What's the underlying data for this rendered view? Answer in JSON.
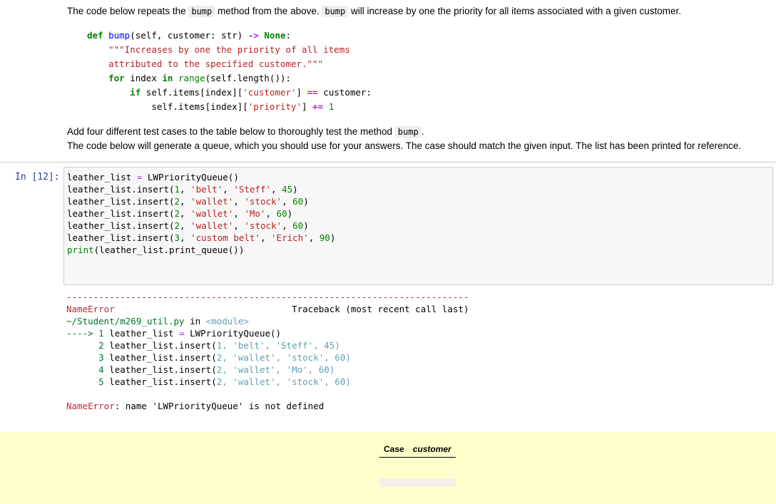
{
  "intro": {
    "p1_before": "The code below repeats the ",
    "p1_code1": "bump",
    "p1_mid": " method from the above. ",
    "p1_code2": "bump",
    "p1_after": " will increase by one the priority for all items associated with a given customer."
  },
  "md_code": {
    "l1_def": "def",
    "l1_name": "bump",
    "l1_args": "(self, customer: str) ",
    "l1_arrow": "->",
    "l1_none": "None",
    "l1_colon": ":",
    "l2": "\"\"\"Increases by one the priority of all items",
    "l3": "attributed to the specified customer.\"\"\"",
    "l4_for": "for",
    "l4_index": " index ",
    "l4_in": "in",
    "l4_range": "range",
    "l4_rest": "(self.length()):",
    "l5_if": "if",
    "l5_a": " self.items[index][",
    "l5_str": "'customer'",
    "l5_b": "] ",
    "l5_op": "==",
    "l5_c": " customer:",
    "l6_a": "self.items[index][",
    "l6_str": "'priority'",
    "l6_b": "] ",
    "l6_op": "+=",
    "l6_num": "1"
  },
  "instructions": {
    "p2_before": "Add four different test cases to the table below to thoroughly test the method ",
    "p2_code": "bump",
    "p2_after": ".",
    "p3": "The code below will generate a queue, which you should use for your answers. The case should match the given input. The list has been printed for reference."
  },
  "cell": {
    "prompt": "In [12]:",
    "lines": [
      [
        "leather_list ",
        "= ",
        "LWPriorityQueue()"
      ],
      [
        "leather_list.insert(",
        "1",
        ", ",
        "'belt'",
        ", ",
        "'Steff'",
        ", ",
        "45",
        ")"
      ],
      [
        "leather_list.insert(",
        "2",
        ", ",
        "'wallet'",
        ", ",
        "'stock'",
        ", ",
        "60",
        ")"
      ],
      [
        "leather_list.insert(",
        "2",
        ", ",
        "'wallet'",
        ", ",
        "'Mo'",
        ", ",
        "60",
        ")"
      ],
      [
        "leather_list.insert(",
        "2",
        ", ",
        "'wallet'",
        ", ",
        "'stock'",
        ", ",
        "60",
        ")"
      ],
      [
        "leather_list.insert(",
        "3",
        ", ",
        "'custom belt'",
        ", ",
        "'Erich'",
        ", ",
        "90",
        ")"
      ],
      [
        "print",
        "(leather_list.print_queue())"
      ]
    ]
  },
  "output": {
    "dashes": "---------------------------------------------------------------------------",
    "error_name": "NameError",
    "traceback_label": "Traceback (most recent call last)",
    "file_path": "~/Student/m269_util.py",
    "in_word": " in ",
    "module": "<module>",
    "arrow": "---->",
    "tb_lines": [
      {
        "num": "1",
        "text": "leather_list ",
        "op": "=",
        "rest": " LWPriorityQueue()"
      },
      {
        "num": "2",
        "pre": "leather_list.insert(",
        "args": "1, 'belt', 'Steff', 45)"
      },
      {
        "num": "3",
        "pre": "leather_list.insert(",
        "args": "2, 'wallet', 'stock', 60)"
      },
      {
        "num": "4",
        "pre": "leather_list.insert(",
        "args": "2, 'wallet', 'Mo', 60)"
      },
      {
        "num": "5",
        "pre": "leather_list.insert(",
        "args": "2, 'wallet', 'stock', 60)"
      }
    ],
    "final_error": "NameError",
    "final_msg": ": name 'LWPriorityQueue' is not defined"
  },
  "answer_table": {
    "col_case": "Case",
    "col_customer": "customer"
  }
}
